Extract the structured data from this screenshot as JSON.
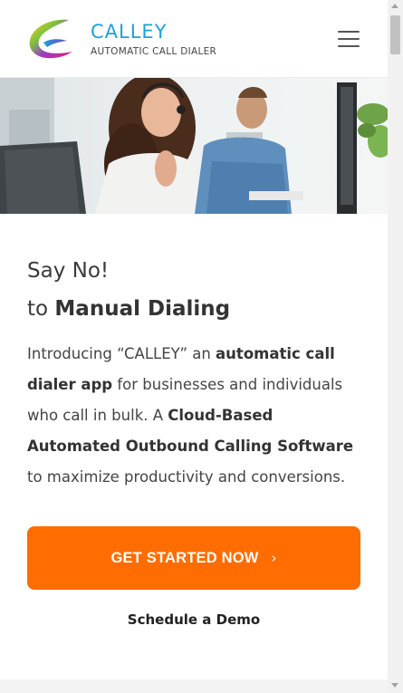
{
  "header": {
    "brand": "CALLEY",
    "tagline": "AUTOMATIC CALL DIALER",
    "logo_icon": "calley-swoosh-logo",
    "menu_icon": "hamburger-menu-icon"
  },
  "hero": {
    "image": "call-center-agents-with-headsets"
  },
  "main": {
    "heading_line1": "Say No!",
    "heading_to": "to",
    "heading_bold": "Manual Dialing",
    "intro": {
      "p1": "Introducing “CALLEY” an ",
      "b1": "automatic call dialer app",
      "p2": " for businesses and individuals who call in bulk. A ",
      "b2": "Cloud-Based Automated Outbound Calling Software",
      "p3": " to maximize productivity and conversions."
    },
    "cta_label": "GET STARTED NOW",
    "cta_icon": "chevron-right-icon",
    "demo_label": "Schedule a Demo"
  },
  "colors": {
    "accent": "#ff6c00",
    "brand": "#1aa3d9",
    "text": "#3a3a3a"
  }
}
